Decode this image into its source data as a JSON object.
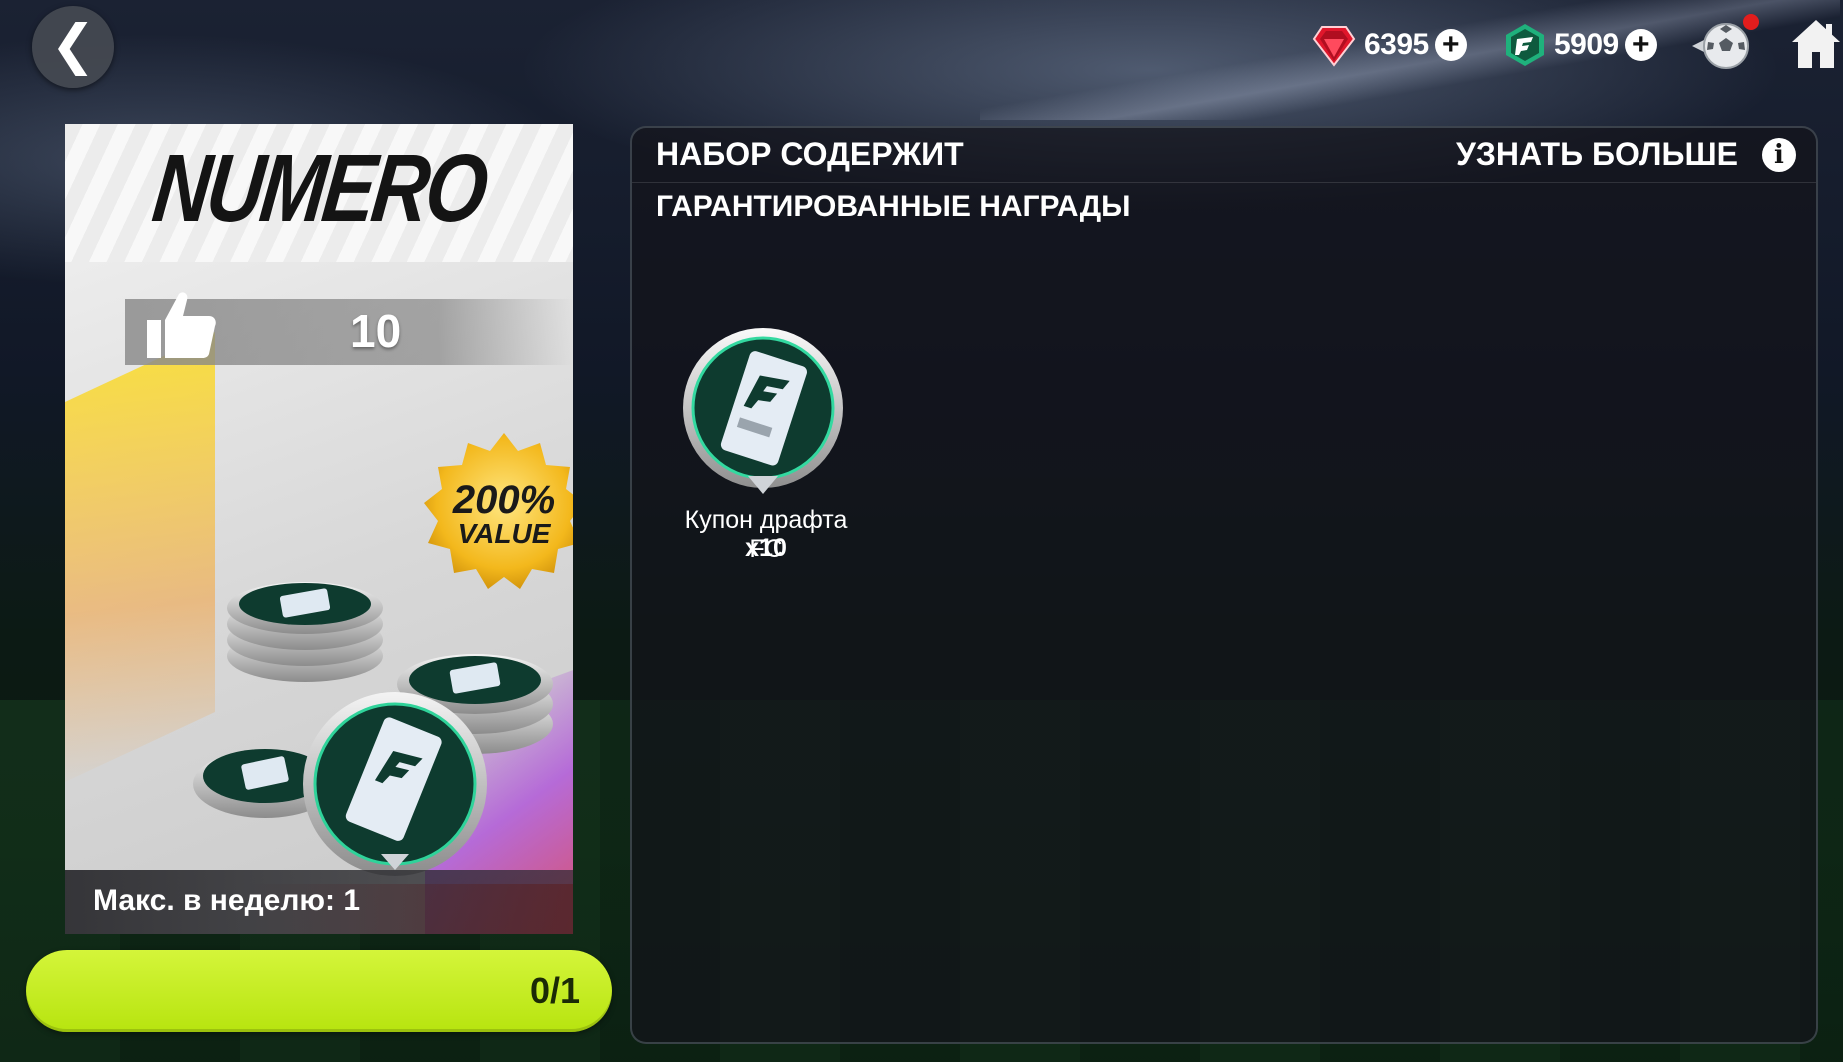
{
  "topbar": {
    "back_icon": "chevron-left-icon",
    "gems": {
      "icon": "red-gem-icon",
      "value": "6395",
      "color": "#e0162b"
    },
    "fc_points": {
      "icon": "fc-points-icon",
      "value": "5909",
      "color": "#1fb17c"
    },
    "ball_icon": "soccer-ball-icon",
    "home_icon": "home-icon",
    "notification_color": "#e21d1d"
  },
  "pack": {
    "title": "NUMERO",
    "likes": "10",
    "badge": {
      "percent": "200%",
      "label": "VALUE"
    },
    "limit": "Макс. в неделю: 1"
  },
  "purchase": {
    "progress_text": "0/1",
    "progress": 0,
    "color": "#c6ee22"
  },
  "contents": {
    "title": "НАБОР СОДЕРЖИТ",
    "learn_more": "УЗНАТЬ БОЛЬШЕ",
    "info_icon": "info-icon",
    "section": "ГАРАНТИРОВАННЫЕ НАГРАДЫ",
    "rewards": [
      {
        "name": "Купон драфта FC",
        "qty": "x10",
        "icon": "fc-draft-coupon-icon"
      }
    ]
  }
}
